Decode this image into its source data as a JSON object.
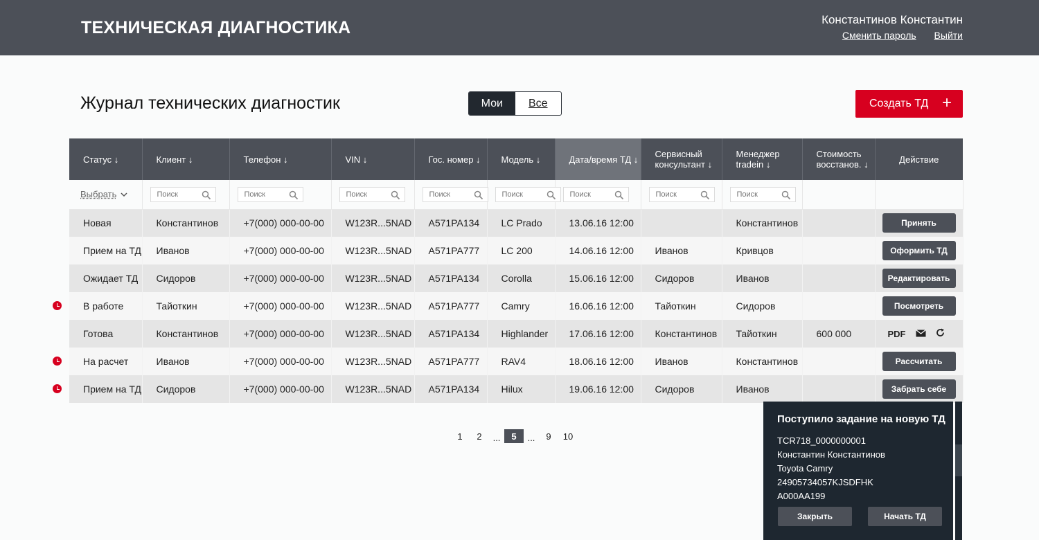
{
  "header": {
    "title": "ТЕХНИЧЕСКАЯ ДИАГНОСТИКА",
    "user_name": "Константинов Константин",
    "change_password": "Сменить пароль",
    "logout": "Выйти"
  },
  "page": {
    "title": "Журнал технических диагностик",
    "toggle": {
      "mine": "Мои",
      "all": "Все",
      "selected": "Мои"
    },
    "create_button": "Создать ТД",
    "create_icon": "plus-icon"
  },
  "table": {
    "columns": [
      "Статус ↓",
      "Клиент ↓",
      "Телефон ↓",
      "VIN ↓",
      "Гос. номер ↓",
      "Модель ↓",
      "Дата/время ТД ↓",
      "Сервисный консультант ↓",
      "Менеджер tradein ↓",
      "Стоимость восстанов. ↓",
      "Действие"
    ],
    "sorted_column": "Дата/время ТД ↓",
    "filters": {
      "status_select": "Выбрать",
      "search_placeholder": "Поиск"
    },
    "rows": [
      {
        "status": "Новая",
        "client": "Константинов",
        "phone": "+7(000) 000-00-00",
        "vin": "W123R...5NAD",
        "plate": "A571PA134",
        "model": "LC Prado",
        "datetime": "13.06.16  12:00",
        "consultant": "",
        "manager": "Константинов",
        "cost": "",
        "action": "Принять",
        "overdue": false
      },
      {
        "status": "Прием на ТД",
        "client": "Иванов",
        "phone": "+7(000) 000-00-00",
        "vin": "W123R...5NAD",
        "plate": "A571PA777",
        "model": "LC 200",
        "datetime": "14.06.16  12:00",
        "consultant": "Иванов",
        "manager": "Кривцов",
        "cost": "",
        "action": "Оформить ТД",
        "overdue": false
      },
      {
        "status": "Ожидает ТД",
        "client": "Сидоров",
        "phone": "+7(000) 000-00-00",
        "vin": "W123R...5NAD",
        "plate": "A571PA134",
        "model": "Corolla",
        "datetime": "15.06.16  12:00",
        "consultant": "Сидоров",
        "manager": "Иванов",
        "cost": "",
        "action": "Редактировать",
        "overdue": false
      },
      {
        "status": "В работе",
        "client": "Тайоткин",
        "phone": "+7(000) 000-00-00",
        "vin": "W123R...5NAD",
        "plate": "A571PA777",
        "model": "Camry",
        "datetime": "16.06.16  12:00",
        "consultant": "Тайоткин",
        "manager": "Сидоров",
        "cost": "",
        "action": "Посмотреть",
        "overdue": true
      },
      {
        "status": "Готова",
        "client": "Константинов",
        "phone": "+7(000) 000-00-00",
        "vin": "W123R...5NAD",
        "plate": "A571PA134",
        "model": "Highlander",
        "datetime": "17.06.16  12:00",
        "consultant": "Константинов",
        "manager": "Тайоткин",
        "cost": "600 000",
        "action": "",
        "overdue": false
      },
      {
        "status": "На расчет",
        "client": "Иванов",
        "phone": "+7(000) 000-00-00",
        "vin": "W123R...5NAD",
        "plate": "A571PA777",
        "model": "RAV4",
        "datetime": "18.06.16  12:00",
        "consultant": "Иванов",
        "manager": "Константинов",
        "cost": "",
        "action": "Рассчитать",
        "overdue": true
      },
      {
        "status": "Прием на ТД",
        "client": "Сидоров",
        "phone": "+7(000) 000-00-00",
        "vin": "W123R...5NAD",
        "plate": "A571PA134",
        "model": "Hilux",
        "datetime": "19.06.16  12:00",
        "consultant": "Сидоров",
        "manager": "Иванов",
        "cost": "",
        "action": "Забрать себе",
        "overdue": true
      }
    ],
    "ready_actions": {
      "pdf": "PDF",
      "icons": [
        "mail-icon",
        "refresh-icon"
      ]
    },
    "overdue_icon": "clock-icon"
  },
  "pagination": {
    "items": [
      "1",
      "2",
      "...",
      "5",
      "...",
      "9",
      "10"
    ],
    "current": "5"
  },
  "notification": {
    "title": "Поступило задание на новую ТД",
    "lines": [
      "TCR718_0000000001",
      "Константин Константинов",
      "Toyota Camry",
      "24905734057KJSDFHK",
      "A000AA199"
    ],
    "close": "Закрыть",
    "start": "Начать ТД"
  },
  "colors": {
    "header": "#4c5058",
    "accent": "#d7001f",
    "dark": "#1e2730"
  }
}
